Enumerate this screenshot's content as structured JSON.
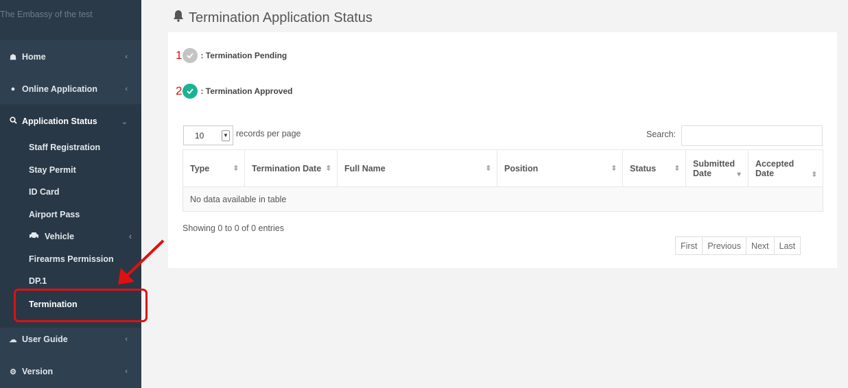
{
  "brand": "The Embassy of the test",
  "sidebar": {
    "items": [
      {
        "label": "Home",
        "icon": "home-icon"
      },
      {
        "label": "Online Application",
        "icon": "user-icon"
      },
      {
        "label": "Application Status",
        "icon": "search-icon"
      },
      {
        "label": "User Guide",
        "icon": "cloud-icon"
      },
      {
        "label": "Version",
        "icon": "gears-icon"
      }
    ],
    "sub_items": [
      "Staff Registration",
      "Stay Permit",
      "ID Card",
      "Airport Pass",
      "Vehicle",
      "Firearms Permission",
      "DP.1",
      "Termination"
    ]
  },
  "page_title": "Termination Application Status",
  "legend": [
    {
      "num": "1",
      "label": ": Termination Pending",
      "color": "#c4c4c4"
    },
    {
      "num": "2",
      "label": ": Termination Approved",
      "color": "#1ab394"
    }
  ],
  "table_controls": {
    "length_value": "10",
    "length_label": "records per page",
    "search_label": "Search:"
  },
  "table": {
    "columns": [
      "Type",
      "Termination Date",
      "Full Name",
      "Position",
      "Status",
      "Submitted Date",
      "Accepted Date"
    ],
    "empty_message": "No data available in table"
  },
  "info": "Showing 0 to 0 of 0 entries",
  "pager": [
    "First",
    "Previous",
    "Next",
    "Last"
  ],
  "colors": {
    "sidebar": "#2f4050",
    "accent": "#1ab394",
    "annotation": "#e01010"
  }
}
